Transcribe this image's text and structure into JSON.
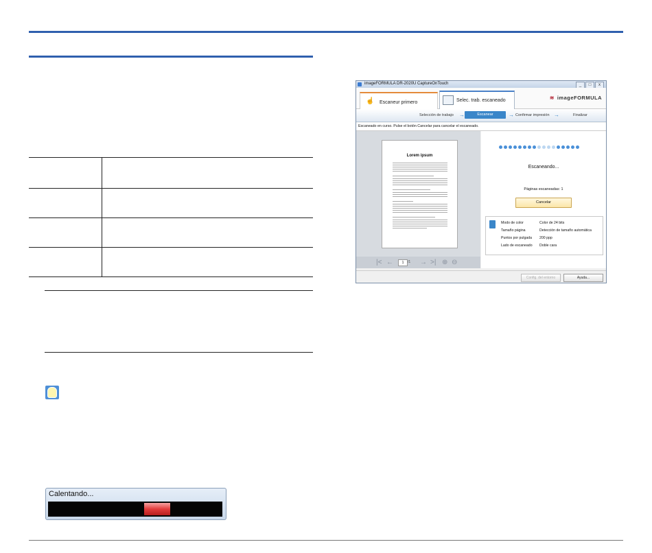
{
  "warming_dialog": {
    "label": "Calentando...",
    "progress_indicator": "red-segment"
  },
  "app": {
    "title": "imageFORMULA DR-2020U CaptureOnTouch",
    "window_buttons": {
      "minimize": "_",
      "maximize": "□",
      "close": "x"
    },
    "tabs": [
      {
        "label": "Escaneur primero",
        "icon": "hand-icon"
      },
      {
        "label": "Selec. trab. escaneado",
        "icon": "job-list-icon"
      }
    ],
    "brand": "imageFORMULA",
    "steps": [
      {
        "label": "Selección de trabajo",
        "active": false
      },
      {
        "label": "Escanear",
        "active": true
      },
      {
        "label": "Confirmar impresión",
        "active": false
      },
      {
        "label": "Finalizar",
        "active": false
      }
    ],
    "status_message": "Escaneado en curso. Pulse el botón Cancelar para cancelar el escaneado.",
    "preview": {
      "heading": "Lorem ipsum",
      "page_number": "1",
      "page_total": "/1"
    },
    "scanning_text": "Escaneando...",
    "pages_scanned_label": "Páginas escaneadas: 1",
    "cancel_label": "Cancelar",
    "settings": [
      {
        "label": "Modo de color",
        "value": "Color de 24 bits"
      },
      {
        "label": "Tamaño página",
        "value": "Detección de tamaño automática"
      },
      {
        "label": "Puntos por pulgada",
        "value": "200 ppp"
      },
      {
        "label": "Lado de escaneado",
        "value": "Doble cara"
      }
    ],
    "footer": {
      "config_label": "Config. del entorno",
      "help_label": "Ayuda..."
    },
    "colors": {
      "accent": "#3a86c9",
      "tab_highlight": "#e48a3a",
      "brand_mark": "#b01e2e"
    }
  }
}
